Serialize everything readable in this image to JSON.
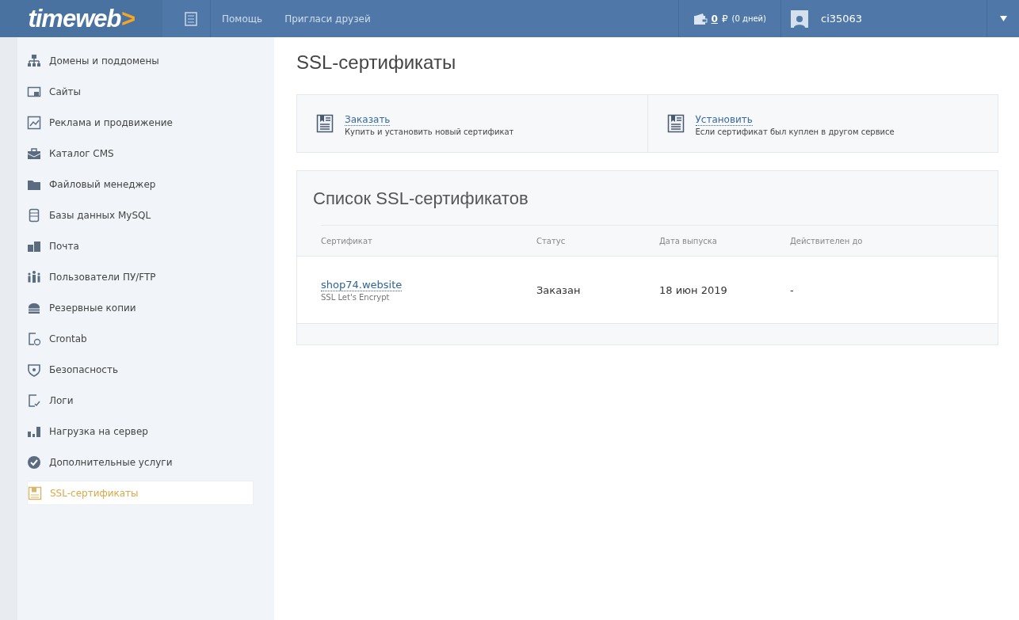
{
  "header": {
    "logo": "timeweb",
    "logo_mark": ">",
    "links": [
      "Помощь",
      "Пригласи друзей"
    ],
    "balance": {
      "amount": "0",
      "currency": "₽",
      "days": "(0 дней)"
    },
    "user": "ci35063"
  },
  "sidebar": {
    "items": [
      {
        "label": "Домены и поддомены",
        "selected": false
      },
      {
        "label": "Сайты",
        "selected": false
      },
      {
        "label": "Реклама и продвижение",
        "selected": false
      },
      {
        "label": "Каталог CMS",
        "selected": false
      },
      {
        "label": "Файловый менеджер",
        "selected": false
      },
      {
        "label": "Базы данных MySQL",
        "selected": false
      },
      {
        "label": "Почта",
        "selected": false
      },
      {
        "label": "Пользователи ПУ/FTP",
        "selected": false
      },
      {
        "label": "Резервные копии",
        "selected": false
      },
      {
        "label": "Crontab",
        "selected": false
      },
      {
        "label": "Безопасность",
        "selected": false
      },
      {
        "label": "Логи",
        "selected": false
      },
      {
        "label": "Нагрузка на сервер",
        "selected": false
      },
      {
        "label": "Дополнительные услуги",
        "selected": false
      },
      {
        "label": "SSL-сертификаты",
        "selected": true
      }
    ]
  },
  "page_title": "SSL-сертификаты",
  "actions": [
    {
      "title": "Заказать",
      "description": "Купить и установить новый сертификат"
    },
    {
      "title": "Установить",
      "description": "Если сертификат был куплен в другом сервисе"
    }
  ],
  "list": {
    "title": "Список SSL-сертификатов",
    "columns": [
      "Сертификат",
      "Статус",
      "Дата выпуска",
      "Действителен до"
    ],
    "rows": [
      {
        "domain": "shop74.website",
        "type": "SSL Let's Encrypt",
        "status": "Заказан",
        "issued": "18 июн 2019",
        "valid_until": "-"
      }
    ]
  }
}
